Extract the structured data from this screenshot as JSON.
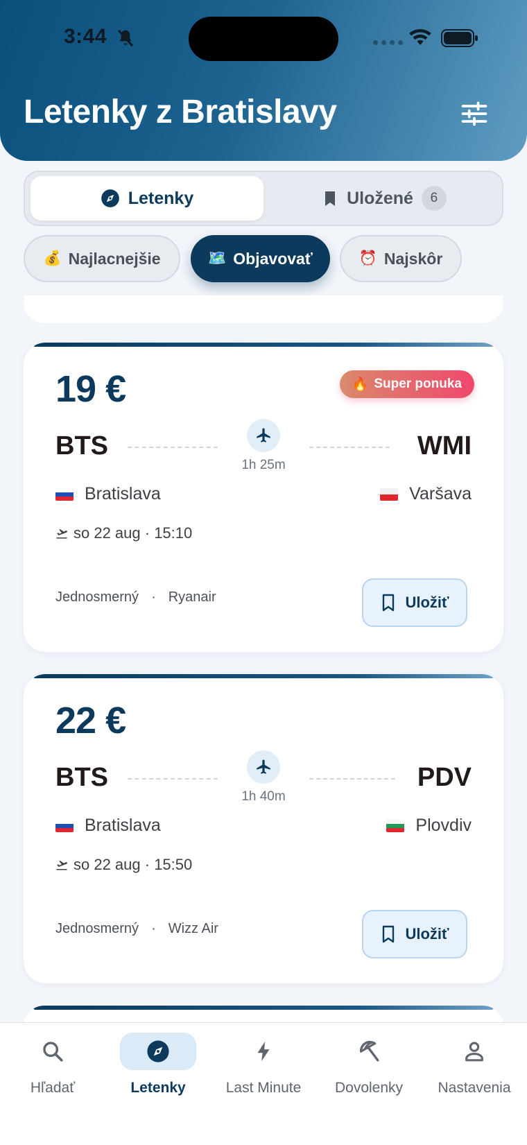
{
  "status_bar": {
    "time": "3:44"
  },
  "header": {
    "title": "Letenky z Bratislavy"
  },
  "tabs": [
    {
      "label": "Letenky",
      "active": true
    },
    {
      "label": "Uložené",
      "badge": "6",
      "active": false
    }
  ],
  "chips": [
    {
      "emoji": "💰",
      "label": "Najlacnejšie",
      "active": false
    },
    {
      "emoji": "🗺️",
      "label": "Objavovať",
      "active": true
    },
    {
      "emoji": "⏰",
      "label": "Najskôr",
      "active": false
    }
  ],
  "flights": [
    {
      "price": "19 €",
      "deal": {
        "emoji": "🔥",
        "label": "Super ponuka"
      },
      "from_code": "BTS",
      "to_code": "WMI",
      "duration": "1h 25m",
      "from_city": "Bratislava",
      "to_city": "Varšava",
      "departure": "so 22 aug · 15:10",
      "trip_type": "Jednosmerný",
      "separator": "·",
      "airline": "Ryanair",
      "save_label": "Uložiť"
    },
    {
      "price": "22 €",
      "from_code": "BTS",
      "to_code": "PDV",
      "duration": "1h 40m",
      "from_city": "Bratislava",
      "to_city": "Plovdiv",
      "departure": "so 22 aug · 15:50",
      "trip_type": "Jednosmerný",
      "separator": "·",
      "airline": "Wizz Air",
      "save_label": "Uložiť"
    }
  ],
  "nav": [
    {
      "label": "Hľadať",
      "icon": "search-icon",
      "active": false
    },
    {
      "label": "Letenky",
      "icon": "compass-icon",
      "active": true
    },
    {
      "label": "Last Minute",
      "icon": "bolt-icon",
      "active": false
    },
    {
      "label": "Dovolenky",
      "icon": "beach-umbrella-icon",
      "active": false
    },
    {
      "label": "Nastavenia",
      "icon": "user-icon",
      "active": false
    }
  ],
  "colors": {
    "primary": "#0b3a5c",
    "header_gradient_start": "#0b4f7c",
    "header_gradient_end": "#5f9cc1",
    "deal_gradient_end": "#f0476c",
    "active_nav_bg": "#daeaf6"
  }
}
